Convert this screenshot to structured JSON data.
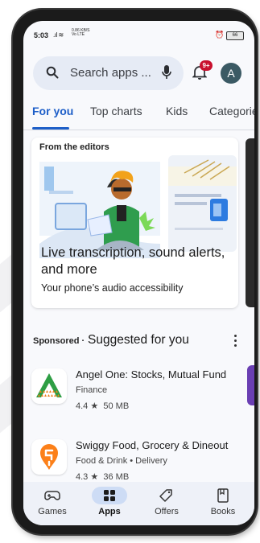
{
  "status_bar": {
    "time": "5:03",
    "network_speed": "0.86 KB/S",
    "network_type": "Vo LTE",
    "battery": "66"
  },
  "search": {
    "placeholder": "Search apps ..."
  },
  "notifications": {
    "badge": "9+"
  },
  "account": {
    "avatar_letter": "A"
  },
  "tabs": [
    {
      "label": "For you",
      "active": true
    },
    {
      "label": "Top charts",
      "active": false
    },
    {
      "label": "Kids",
      "active": false
    },
    {
      "label": "Categorie",
      "active": false
    }
  ],
  "editors_card": {
    "label": "From the editors",
    "title": "Live transcription, sound alerts, and more",
    "subtitle": "Your phone’s audio accessibility"
  },
  "suggested": {
    "sponsored_label": "Sponsored ·",
    "title": "Suggested for you",
    "apps": [
      {
        "name": "Angel One: Stocks, Mutual Fund",
        "category": "Finance",
        "rating": "4.4",
        "size": "50 MB"
      },
      {
        "name": "Swiggy Food, Grocery & Dineout",
        "category": "Food & Drink • Delivery",
        "rating": "4.3",
        "size": "36 MB"
      }
    ]
  },
  "bottom_nav": [
    {
      "label": "Games",
      "icon": "gamepad-icon",
      "active": false
    },
    {
      "label": "Apps",
      "icon": "apps-grid-icon",
      "active": true
    },
    {
      "label": "Offers",
      "icon": "tag-icon",
      "active": false
    },
    {
      "label": "Books",
      "icon": "bookmark-icon",
      "active": false
    }
  ],
  "colors": {
    "accent": "#1d5ec8",
    "badge": "#c8102e",
    "angel_green": "#2e9e44",
    "angel_orange": "#f07d1a",
    "swiggy_orange": "#fc8019"
  }
}
